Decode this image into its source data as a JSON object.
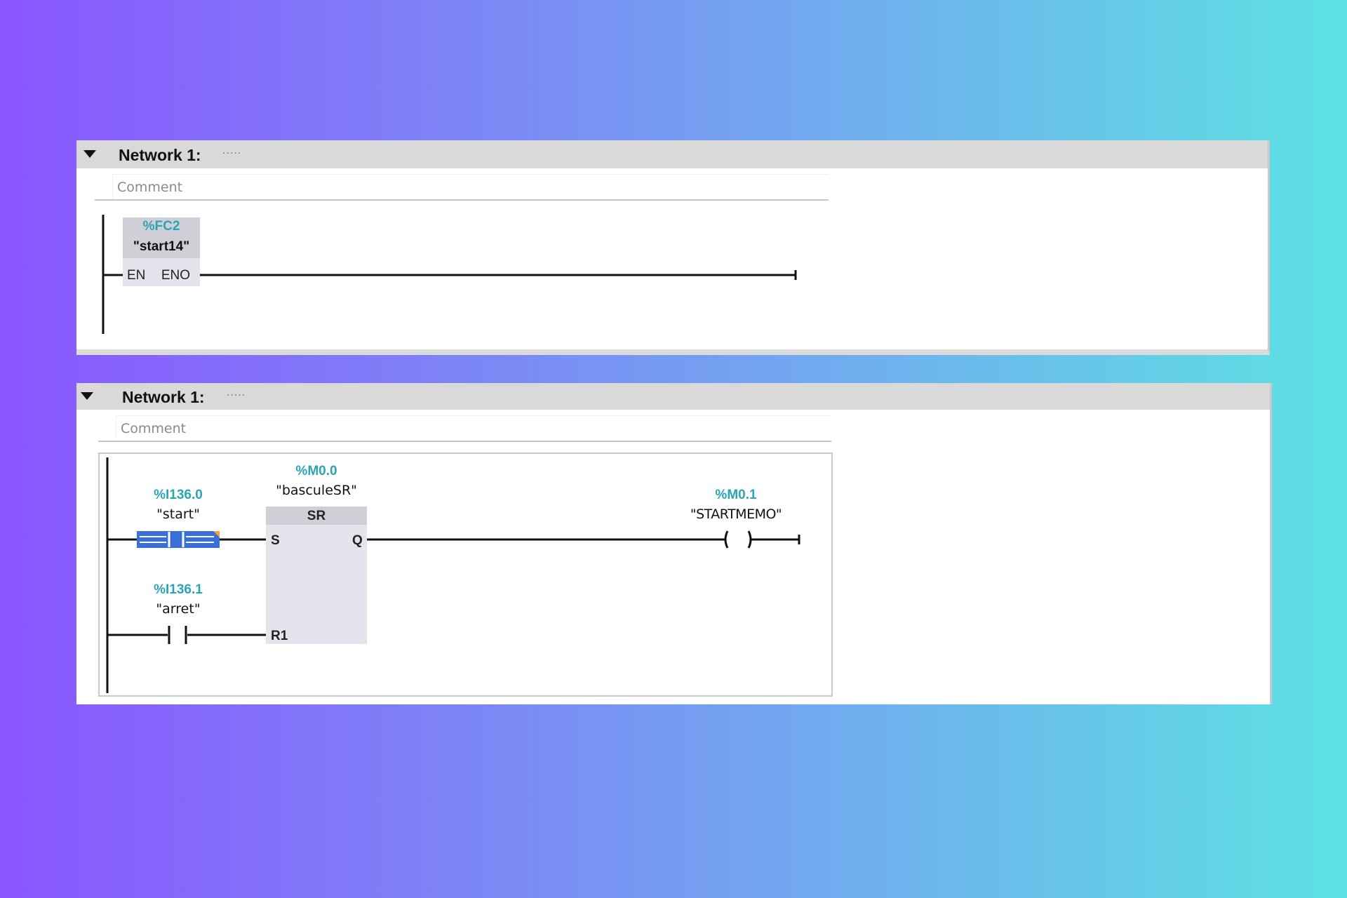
{
  "networks": [
    {
      "title": "Network 1:",
      "dots": ".....",
      "comment": "Comment",
      "block": {
        "address": "%FC2",
        "name": "\"start14\"",
        "in_pin": "EN",
        "out_pin": "ENO"
      }
    },
    {
      "title": "Network 1:",
      "dots": ".....",
      "comment": "Comment",
      "contact_start": {
        "address": "%I136.0",
        "name": "\"start\""
      },
      "contact_stop": {
        "address": "%I136.1",
        "name": "\"arret\""
      },
      "sr_block": {
        "address": "%M0.0",
        "name": "\"basculeSR\"",
        "type": "SR",
        "pin_s": "S",
        "pin_q": "Q",
        "pin_r1": "R1"
      },
      "coil": {
        "address": "%M0.1",
        "name": "\"STARTMEMO\""
      }
    }
  ],
  "colors": {
    "address": "#2ba5b5",
    "selection": "#3a6fd8",
    "header": "#d9d9d9"
  }
}
